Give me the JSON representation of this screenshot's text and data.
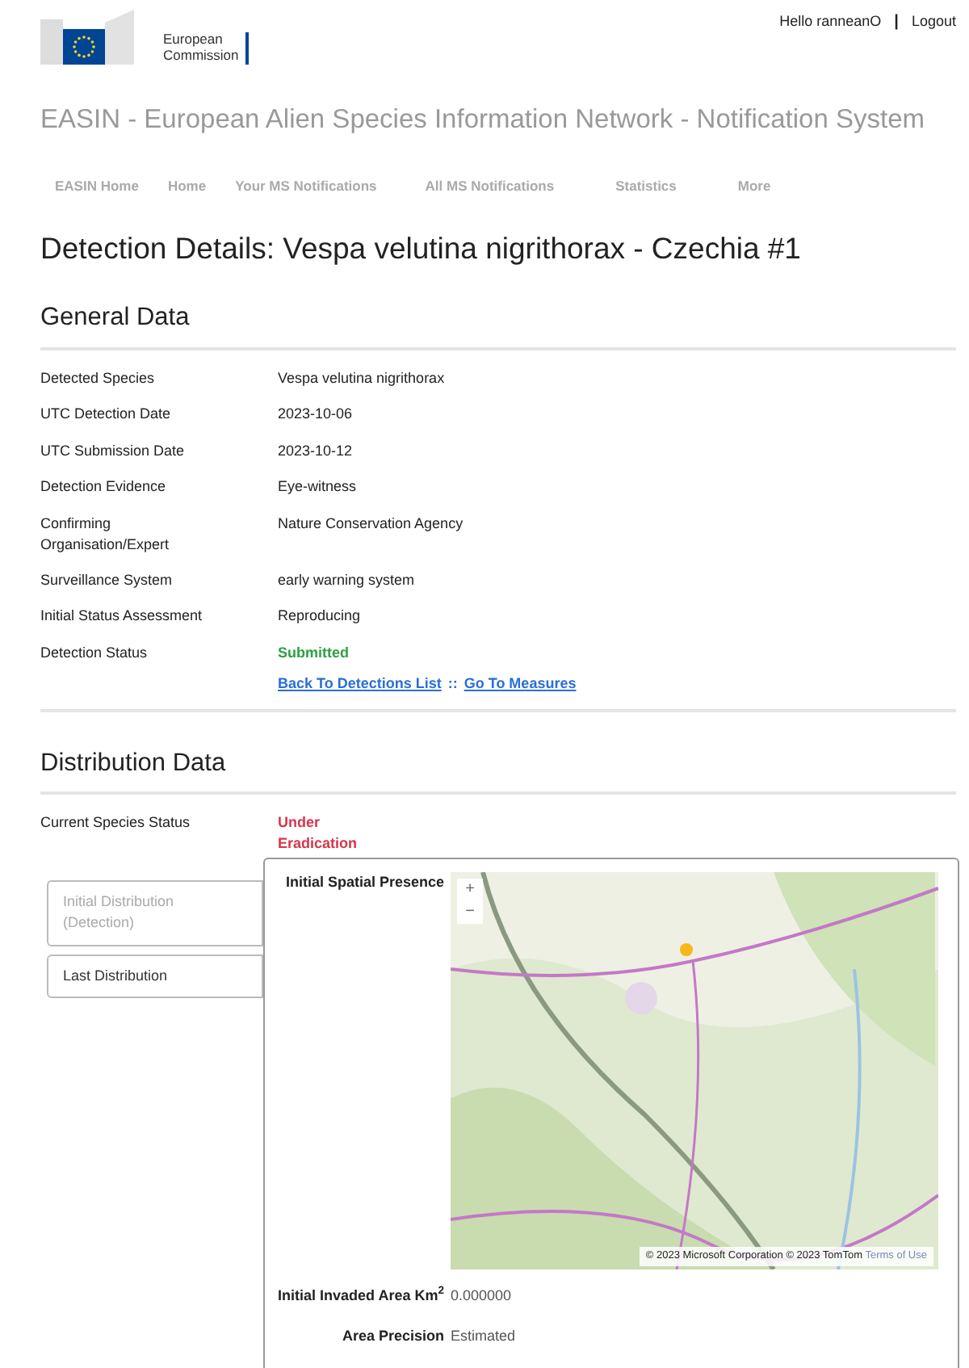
{
  "header": {
    "logo_text": [
      "European",
      "Commission"
    ],
    "greeting": "Hello ranneanO",
    "separator": "|",
    "logout": "Logout"
  },
  "app_title": "EASIN - European Alien Species Information Network - Notification System",
  "nav": [
    {
      "label": "EASIN Home"
    },
    {
      "label": "Home"
    },
    {
      "label": "Your MS Notifications"
    },
    {
      "label": "All MS Notifications"
    },
    {
      "label": "Statistics"
    },
    {
      "label": "More"
    }
  ],
  "page_title": "Detection Details: Vespa velutina nigrithorax - Czechia #1",
  "general": {
    "heading": "General Data",
    "rows": [
      {
        "label": "Detected Species",
        "value": "Vespa velutina nigrithorax",
        "kind": "text"
      },
      {
        "label": "UTC Detection Date",
        "value": "2023-10-06",
        "kind": "text"
      },
      {
        "label": "UTC Submission Date",
        "value": "2023-10-12",
        "kind": "text"
      },
      {
        "label": "Detection Evidence",
        "value": "Eye-witness",
        "kind": "text"
      },
      {
        "label": "Confirming Organisation/Expert",
        "value": "Nature Conservation Agency",
        "kind": "text"
      },
      {
        "label": "Surveillance System",
        "value": "early warning system",
        "kind": "text"
      },
      {
        "label": "Initial Status Assessment",
        "value": "Reproducing",
        "kind": "text"
      },
      {
        "label": "Detection Status",
        "value": "Submitted",
        "kind": "status",
        "color": "#2ea043"
      }
    ],
    "links": [
      "Back To Detections List",
      "::",
      "Go To Measures"
    ]
  },
  "distribution": {
    "heading": "Distribution Data",
    "status": {
      "label": "Current Species Status",
      "value": "Under Eradication",
      "color": "#d6354a"
    },
    "tabs": [
      {
        "label": "Initial Distribution (Detection)",
        "selected": true
      },
      {
        "label": "Last Distribution",
        "selected": false
      }
    ],
    "panel": {
      "map_label": "Initial Spatial Presence",
      "zoom_in": "+",
      "zoom_out": "−",
      "attribution": "© 2023 Microsoft Corporation © 2023 TomTom",
      "terms_link": "Terms of Use",
      "fields": [
        {
          "label": "Initial Invaded Area Km$^{2}$",
          "value": "0.000000"
        },
        {
          "label": "Area Precision",
          "value": "Estimated"
        }
      ]
    }
  }
}
